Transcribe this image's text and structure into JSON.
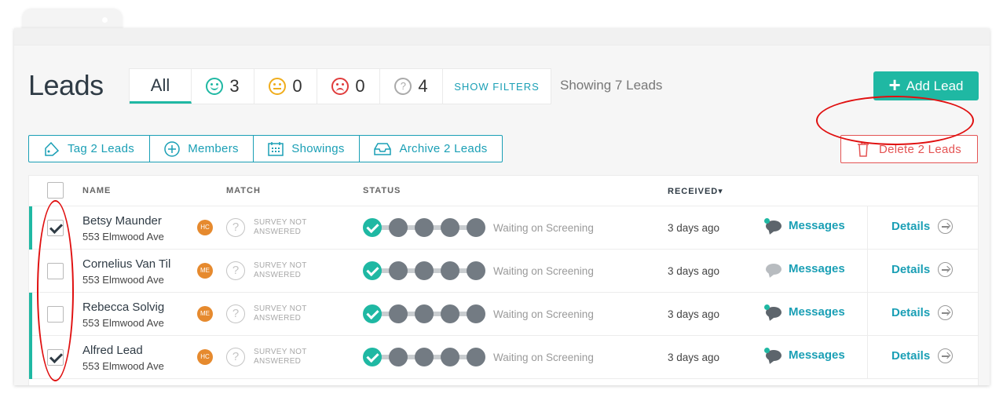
{
  "page": {
    "title": "Leads",
    "showing": "Showing 7 Leads"
  },
  "filters": {
    "all": "All",
    "happy": "3",
    "neutral": "0",
    "sad": "0",
    "unknown": "4",
    "show_filters": "SHOW FILTERS"
  },
  "add_lead": "Add Lead",
  "actions": {
    "tag": "Tag 2 Leads",
    "members": "Members",
    "showings": "Showings",
    "archive": "Archive 2 Leads",
    "delete": "Delete 2 Leads"
  },
  "columns": {
    "name": "NAME",
    "match": "MATCH",
    "status": "STATUS",
    "received": "RECEIVED"
  },
  "rows": [
    {
      "name": "Betsy Maunder",
      "address": "553 Elmwood Ave",
      "agent": "HC",
      "survey1": "SURVEY NOT",
      "survey2": "ANSWERED",
      "status": "Waiting on Screening",
      "received": "3 days ago",
      "messages": "Messages",
      "details": "Details",
      "checked": true,
      "highlighted": true
    },
    {
      "name": "Cornelius Van Til",
      "address": "553 Elmwood Ave",
      "agent": "ME",
      "survey1": "SURVEY NOT",
      "survey2": "ANSWERED",
      "status": "Waiting on Screening",
      "received": "3 days ago",
      "messages": "Messages",
      "details": "Details",
      "checked": false,
      "highlighted": false
    },
    {
      "name": "Rebecca Solvig",
      "address": "553 Elmwood Ave",
      "agent": "ME",
      "survey1": "SURVEY NOT",
      "survey2": "ANSWERED",
      "status": "Waiting on Screening",
      "received": "3 days ago",
      "messages": "Messages",
      "details": "Details",
      "checked": false,
      "highlighted": true
    },
    {
      "name": "Alfred Lead",
      "address": "553 Elmwood Ave",
      "agent": "HC",
      "survey1": "SURVEY NOT",
      "survey2": "ANSWERED",
      "status": "Waiting on Screening",
      "received": "3 days ago",
      "messages": "Messages",
      "details": "Details",
      "checked": true,
      "highlighted": true
    }
  ],
  "colors": {
    "accent": "#1fb8a3",
    "link": "#1a9fb5",
    "danger": "#e45353",
    "agent": "#e68a2e"
  }
}
